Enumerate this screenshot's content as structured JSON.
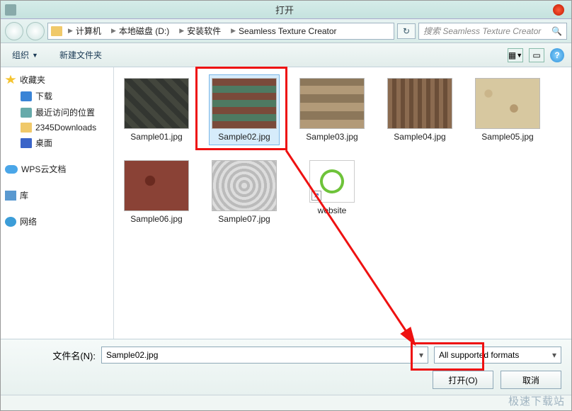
{
  "window": {
    "title": "打开"
  },
  "breadcrumbs": {
    "items": [
      "计算机",
      "本地磁盘 (D:)",
      "安装软件",
      "Seamless Texture Creator"
    ]
  },
  "search": {
    "placeholder": "搜索 Seamless Texture Creator"
  },
  "toolbar": {
    "organize": "组织",
    "newfolder": "新建文件夹"
  },
  "sidebar": {
    "favorites": "收藏夹",
    "downloads": "下载",
    "recent": "最近访问的位置",
    "folder2345": "2345Downloads",
    "desktop": "桌面",
    "wps": "WPS云文档",
    "library": "库",
    "network": "网络"
  },
  "files": {
    "items": [
      {
        "label": "Sample01.jpg",
        "texture": "tx1"
      },
      {
        "label": "Sample02.jpg",
        "texture": "tx2",
        "selected": true
      },
      {
        "label": "Sample03.jpg",
        "texture": "tx3"
      },
      {
        "label": "Sample04.jpg",
        "texture": "tx4"
      },
      {
        "label": "Sample05.jpg",
        "texture": "tx5"
      },
      {
        "label": "Sample06.jpg",
        "texture": "tx6"
      },
      {
        "label": "Sample07.jpg",
        "texture": "tx7"
      }
    ],
    "shortcut": "website"
  },
  "bottom": {
    "filename_label": "文件名(N):",
    "filename_value": "Sample02.jpg",
    "filter": "All supported formats",
    "open": "打开(O)",
    "cancel": "取消"
  },
  "watermark": "极速下载站"
}
